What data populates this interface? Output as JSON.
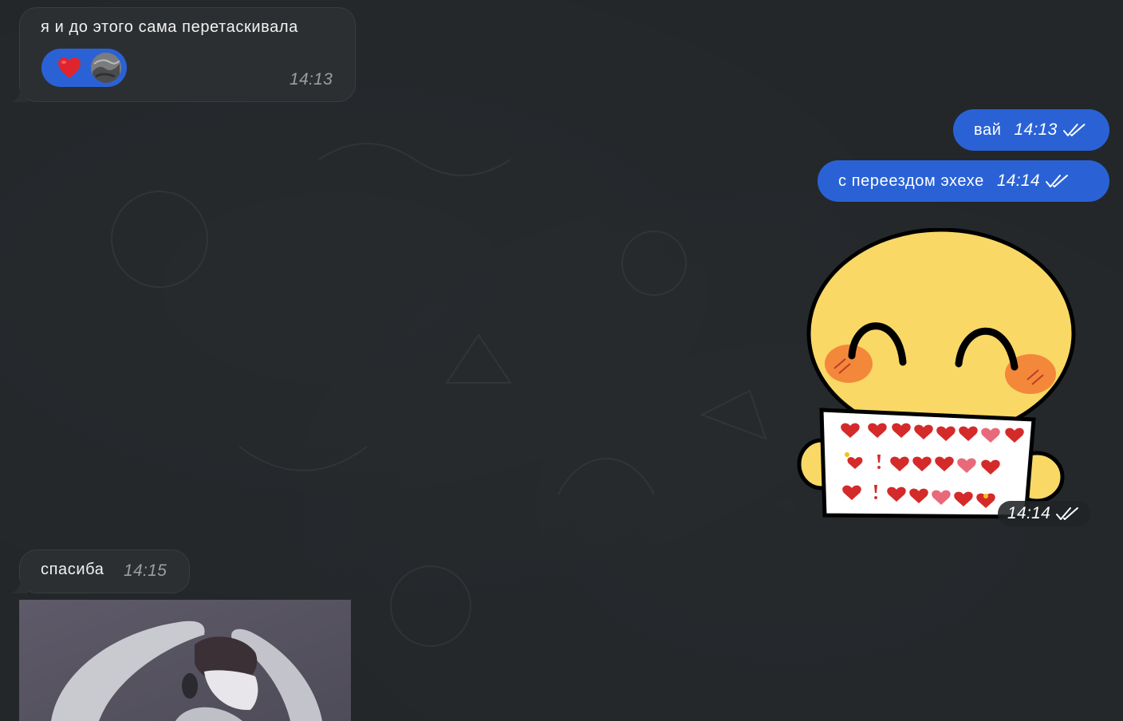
{
  "messages": {
    "m1": {
      "text": "я и до этого сама перетаскивала",
      "time": "14:13"
    },
    "m2": {
      "text": "вай",
      "time": "14:13"
    },
    "m3": {
      "text": "с переездом эхехе",
      "time": "14:14"
    },
    "sticker": {
      "time": "14:14"
    },
    "m4": {
      "text": "спасиба",
      "time": "14:15"
    }
  },
  "reaction": {
    "emoji": "heart-icon"
  },
  "colors": {
    "background": "#23272a",
    "incoming_bubble": "#2c2f31",
    "outgoing_bubble": "#2a62d6",
    "timestamp_incoming": "#9a9fa3"
  }
}
